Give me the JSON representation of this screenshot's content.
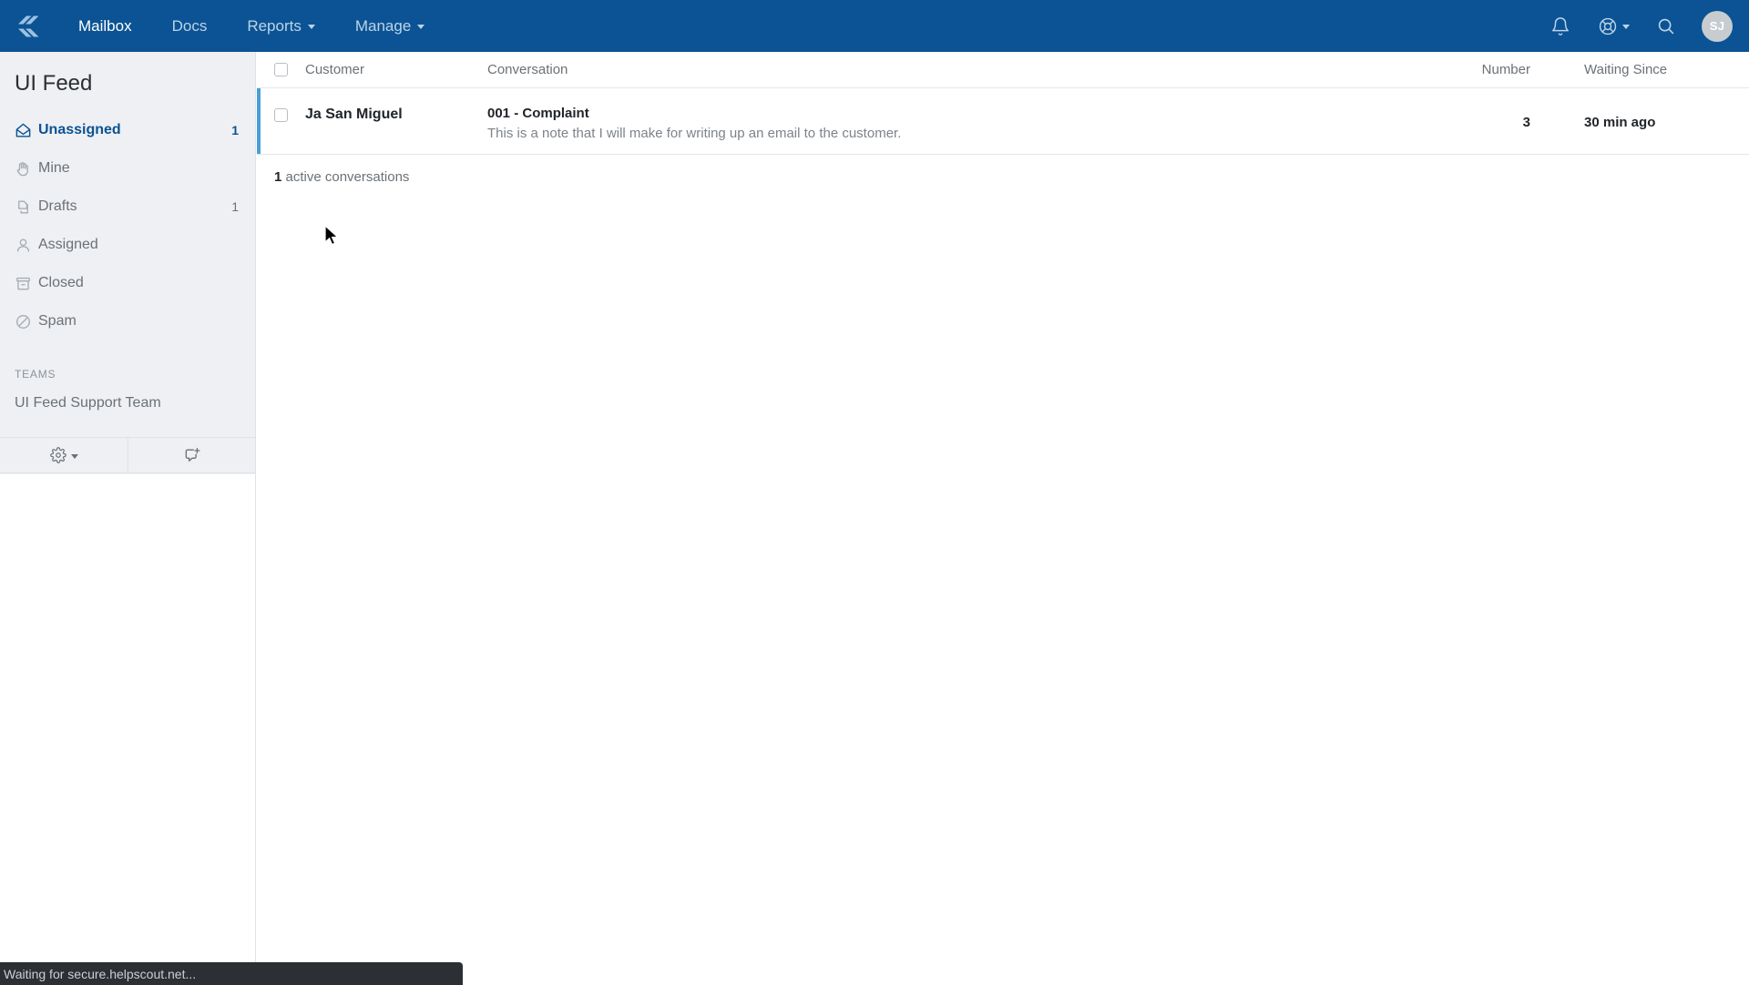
{
  "topnav": {
    "brand_icon": "helpscout-logo-icon",
    "links": [
      {
        "label": "Mailbox",
        "icon": "",
        "has_chevron": false,
        "active": true
      },
      {
        "label": "Docs",
        "icon": "",
        "has_chevron": false,
        "active": false
      },
      {
        "label": "Reports",
        "icon": "",
        "has_chevron": true,
        "active": false
      },
      {
        "label": "Manage",
        "icon": "",
        "has_chevron": true,
        "active": false
      }
    ],
    "right_icons": [
      {
        "name": "notification-bell-icon"
      },
      {
        "name": "help-lifebuoy-icon",
        "has_chevron": true
      },
      {
        "name": "search-icon"
      }
    ],
    "avatar_initials": "SJ",
    "accent_color": "#0b5394"
  },
  "sidebar": {
    "mailbox_title": "UI Feed",
    "folders": [
      {
        "label": "Unassigned",
        "icon": "open-envelope-icon",
        "count": "1",
        "active": true
      },
      {
        "label": "Mine",
        "icon": "hand-icon",
        "count": "",
        "active": false
      },
      {
        "label": "Drafts",
        "icon": "drafts-pages-icon",
        "count": "1",
        "active": false
      },
      {
        "label": "Assigned",
        "icon": "person-icon",
        "count": "",
        "active": false
      },
      {
        "label": "Closed",
        "icon": "archive-box-icon",
        "count": "",
        "active": false
      },
      {
        "label": "Spam",
        "icon": "spam-slash-circle-icon",
        "count": "",
        "active": false
      }
    ],
    "teams_heading": "TEAMS",
    "teams": [
      {
        "label": "UI Feed Support Team"
      }
    ],
    "toolbar": [
      {
        "name": "settings-gear-button",
        "icon": "gear-icon",
        "has_chevron": true
      },
      {
        "name": "new-conversation-button",
        "icon": "new-conversation-icon",
        "has_chevron": false
      }
    ]
  },
  "main": {
    "columns": {
      "customer": "Customer",
      "conversation": "Conversation",
      "number": "Number",
      "waiting_since": "Waiting Since"
    },
    "rows": [
      {
        "customer": "Ja San Miguel",
        "subject": "001 - Complaint",
        "preview": "This is a note that I will make for writing up an email to the customer.",
        "number": "3",
        "waiting_since": "30 min ago"
      }
    ],
    "active_count_number": "1",
    "active_count_label": "active conversations"
  },
  "statusbar": {
    "text": "Waiting for secure.helpscout.net..."
  }
}
